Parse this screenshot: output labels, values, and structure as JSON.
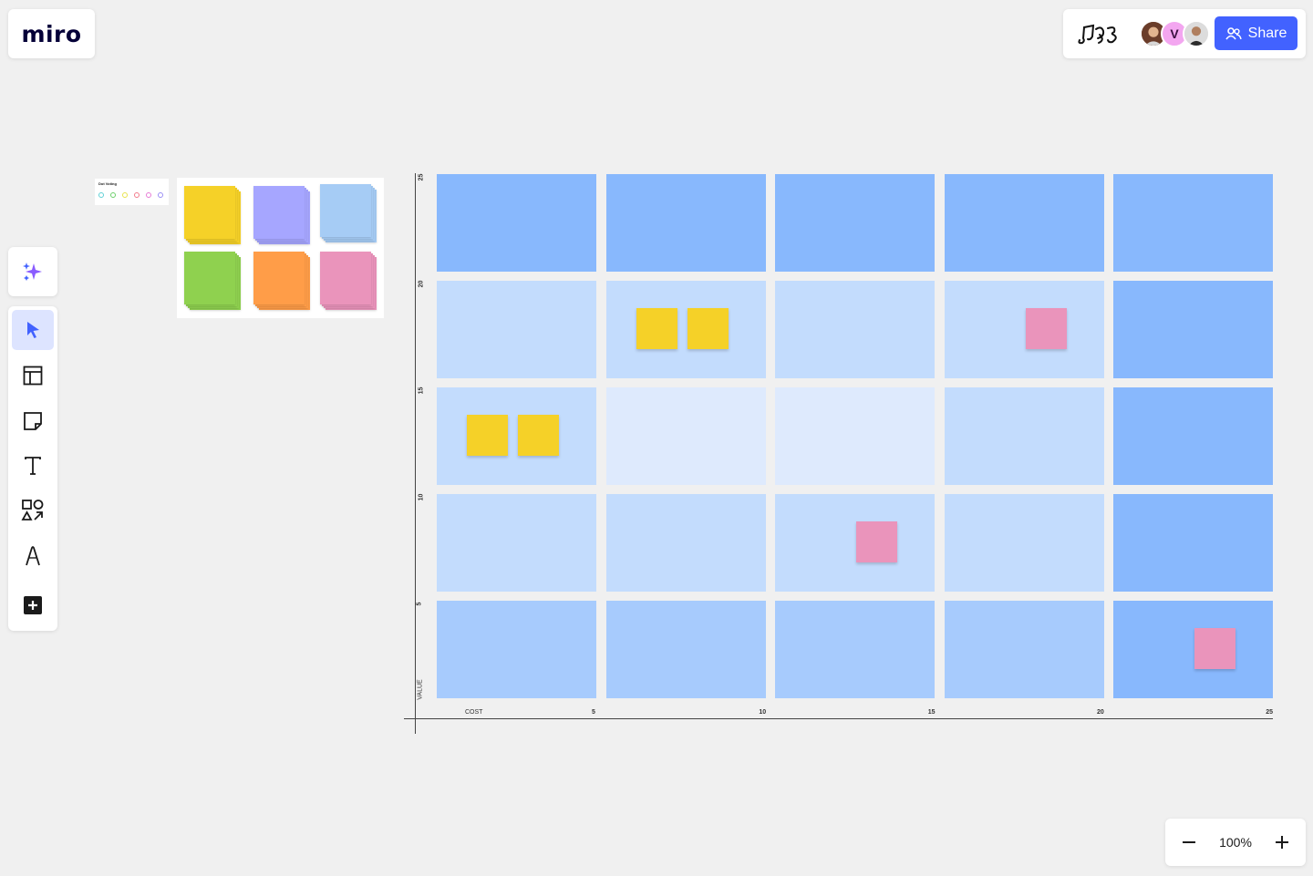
{
  "app": {
    "logo": "miro"
  },
  "header": {
    "share_label": "Share",
    "collaborators": [
      {
        "initial": ""
      },
      {
        "initial": "V"
      },
      {
        "initial": ""
      }
    ]
  },
  "toolbar": {
    "tools": [
      "ai-assist",
      "select",
      "templates",
      "sticky-note",
      "text",
      "shapes",
      "pen",
      "more"
    ],
    "active": "select"
  },
  "zoom": {
    "level": "100%"
  },
  "dot_voting": {
    "title": "Dot Voting",
    "dot_colors": [
      "#5fd0d6",
      "#6ccf6b",
      "#e8e34c",
      "#f27a8a",
      "#e77ad6",
      "#9a8ef5"
    ]
  },
  "sticky_palette": {
    "colors": [
      "#f5d128",
      "#a6a6ff",
      "#a6ccf5",
      "#8fd14f",
      "#ff9d48",
      "#ea94bb"
    ]
  },
  "matrix": {
    "x_label": "COST",
    "y_label": "VALUE",
    "x_ticks": [
      "5",
      "10",
      "15",
      "20",
      "25"
    ],
    "y_ticks": [
      "25",
      "20",
      "15",
      "10",
      "5"
    ],
    "cell_colors": [
      [
        "#88b8fd",
        "#88b8fd",
        "#88b8fd",
        "#88b8fd",
        "#88b8fd"
      ],
      [
        "#c3dcfd",
        "#c3dcfd",
        "#c3dcfd",
        "#c3dcfd",
        "#88b8fd"
      ],
      [
        "#c3dcfd",
        "#deeafd",
        "#deeafd",
        "#c3dcfd",
        "#88b8fd"
      ],
      [
        "#c3dcfd",
        "#c3dcfd",
        "#c3dcfd",
        "#c3dcfd",
        "#88b8fd"
      ],
      [
        "#a7cbfd",
        "#a7cbfd",
        "#a7cbfd",
        "#a7cbfd",
        "#88b8fd"
      ]
    ],
    "stickies": [
      {
        "color": "#f5d128",
        "row": 1,
        "col": 1,
        "slot": 0
      },
      {
        "color": "#f5d128",
        "row": 1,
        "col": 1,
        "slot": 1
      },
      {
        "color": "#ea94bb",
        "row": 1,
        "col": 3,
        "slot": 1
      },
      {
        "color": "#f5d128",
        "row": 2,
        "col": 0,
        "slot": 0
      },
      {
        "color": "#f5d128",
        "row": 2,
        "col": 0,
        "slot": 1
      },
      {
        "color": "#ea94bb",
        "row": 3,
        "col": 2,
        "slot": 1
      },
      {
        "color": "#ea94bb",
        "row": 4,
        "col": 4,
        "slot": 1
      }
    ]
  },
  "colors": {
    "accent": "#4262ff",
    "active_tool_bg": "#dde4ff"
  }
}
